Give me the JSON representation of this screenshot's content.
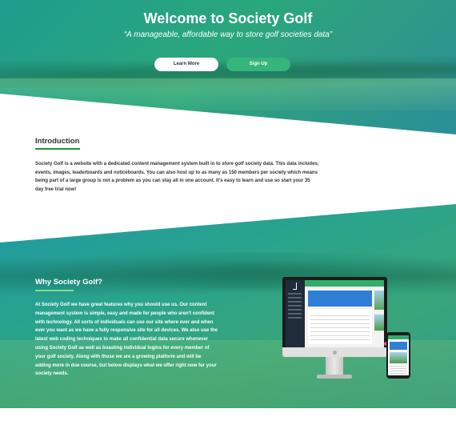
{
  "hero": {
    "title": "Welcome to Society Golf",
    "subtitle": "“A manageable, affordable way to store golf societies data”",
    "learn_more_label": "Learn More",
    "sign_up_label": "Sign Up"
  },
  "intro": {
    "title": "Introduction",
    "body": "Society Golf is a website with a dedicated content management system built in to store golf society data. This data includes; events, images, leaderboards and noticeboards. You can also host up to as many as 150 members per society which means being part of a large group is not a problem as you can stay all in one account. It's easy to learn and use so start your 35 day free trial now!"
  },
  "why": {
    "title": "Why Society Golf?",
    "body": "At Society Golf we have great features why you should use us. Our content management system is simple, easy and made for people who aren't confident with technology. All sorts of individuals can use our site where ever and when ever you want as we have a fully responsive site for all devices. We also use the latest web coding techniques to make all confidential data secure whenever using Society Golf as well as boasting individual logins for every member of your golf society. Along with those we are a growing platform and will be adding more in due course, but below displays what we offer right now for your society needs."
  },
  "colors": {
    "accent_green": "#35b57b",
    "underline_green": "#2c8a3e",
    "hero_teal": "#2aa77c"
  },
  "icons": {
    "device_mockup": "desktop-and-phone-icon"
  }
}
